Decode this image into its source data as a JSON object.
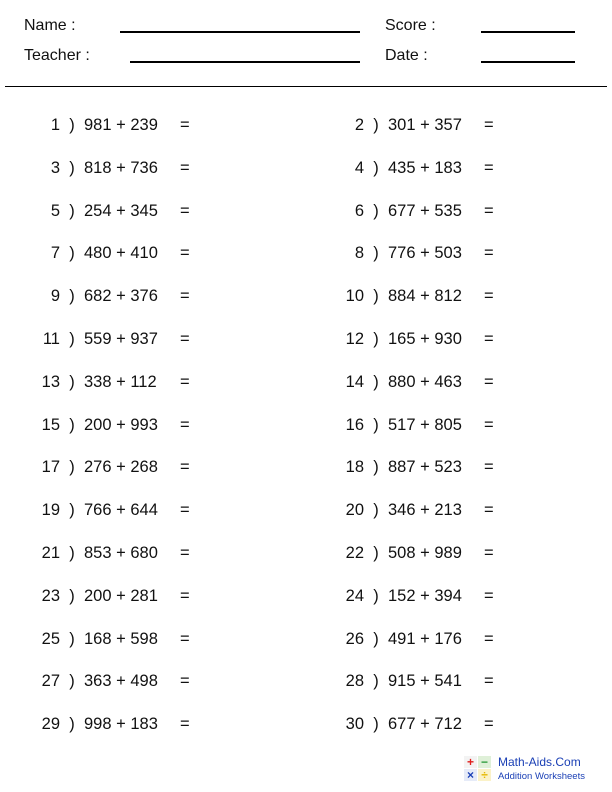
{
  "header": {
    "name_label": "Name :",
    "teacher_label": "Teacher :",
    "score_label": "Score :",
    "date_label": "Date :"
  },
  "problems": [
    {
      "n": "1",
      "a": "981",
      "b": "239"
    },
    {
      "n": "2",
      "a": "301",
      "b": "357"
    },
    {
      "n": "3",
      "a": "818",
      "b": "736"
    },
    {
      "n": "4",
      "a": "435",
      "b": "183"
    },
    {
      "n": "5",
      "a": "254",
      "b": "345"
    },
    {
      "n": "6",
      "a": "677",
      "b": "535"
    },
    {
      "n": "7",
      "a": "480",
      "b": "410"
    },
    {
      "n": "8",
      "a": "776",
      "b": "503"
    },
    {
      "n": "9",
      "a": "682",
      "b": "376"
    },
    {
      "n": "10",
      "a": "884",
      "b": "812"
    },
    {
      "n": "11",
      "a": "559",
      "b": "937"
    },
    {
      "n": "12",
      "a": "165",
      "b": "930"
    },
    {
      "n": "13",
      "a": "338",
      "b": "112"
    },
    {
      "n": "14",
      "a": "880",
      "b": "463"
    },
    {
      "n": "15",
      "a": "200",
      "b": "993"
    },
    {
      "n": "16",
      "a": "517",
      "b": "805"
    },
    {
      "n": "17",
      "a": "276",
      "b": "268"
    },
    {
      "n": "18",
      "a": "887",
      "b": "523"
    },
    {
      "n": "19",
      "a": "766",
      "b": "644"
    },
    {
      "n": "20",
      "a": "346",
      "b": "213"
    },
    {
      "n": "21",
      "a": "853",
      "b": "680"
    },
    {
      "n": "22",
      "a": "508",
      "b": "989"
    },
    {
      "n": "23",
      "a": "200",
      "b": "281"
    },
    {
      "n": "24",
      "a": "152",
      "b": "394"
    },
    {
      "n": "25",
      "a": "168",
      "b": "598"
    },
    {
      "n": "26",
      "a": "491",
      "b": "176"
    },
    {
      "n": "27",
      "a": "363",
      "b": "498"
    },
    {
      "n": "28",
      "a": "915",
      "b": "541"
    },
    {
      "n": "29",
      "a": "998",
      "b": "183"
    },
    {
      "n": "30",
      "a": "677",
      "b": "712"
    }
  ],
  "operator": "+",
  "equals": "=",
  "paren": ")",
  "footer": {
    "logo_title": "Math-Aids.Com",
    "logo_subtitle": "Addition Worksheets",
    "logo_symbols": [
      "+",
      "−",
      "×",
      "÷"
    ],
    "colors": {
      "plus": "#e0201e",
      "minus": "#2a9a3a",
      "times": "#1a3fb5",
      "divide": "#e6b800",
      "text": "#1a3fb5"
    }
  }
}
